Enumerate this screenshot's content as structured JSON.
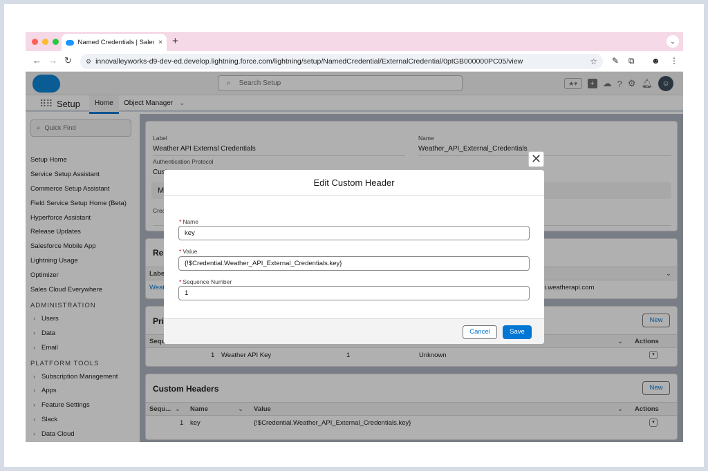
{
  "browser": {
    "tab_title": "Named Credentials | Salesforce",
    "tab_close": "×",
    "new_tab": "+",
    "url": "innovalleyworks-d9-dev-ed.develop.lightning.force.com/lightning/setup/NamedCredential/ExternalCredential/0ptGB000000PC05/view"
  },
  "header": {
    "search_placeholder": "Search Setup"
  },
  "nav": {
    "app_name": "Setup",
    "tabs": [
      {
        "label": "Home"
      },
      {
        "label": "Object Manager"
      }
    ]
  },
  "sidebar": {
    "quick_find_placeholder": "Quick Find",
    "items": [
      "Setup Home",
      "Service Setup Assistant",
      "Commerce Setup Assistant",
      "Field Service Setup Home (Beta)",
      "Hyperforce Assistant",
      "Release Updates",
      "Salesforce Mobile App",
      "Lightning Usage",
      "Optimizer",
      "Sales Cloud Everywhere"
    ],
    "administration_heading": "ADMINISTRATION",
    "administration_items": [
      "Users",
      "Data",
      "Email"
    ],
    "platform_heading": "PLATFORM TOOLS",
    "platform_items": [
      "Subscription Management",
      "Apps",
      "Feature Settings",
      "Slack",
      "Data Cloud"
    ]
  },
  "details": {
    "label_label": "Label",
    "label_value": "Weather API External Credentials",
    "name_label": "Name",
    "name_value": "Weather_API_External_Credentials",
    "auth_label": "Authentication Protocol",
    "auth_value": "Custom",
    "section_partial": "Ma",
    "created_partial": "Crea"
  },
  "related": {
    "title_partial": "Rel",
    "label_partial": "Labe",
    "link_partial": "Weat",
    "url_partial": "api.weatherapi.com"
  },
  "principals": {
    "title_partial": "Prin",
    "new_label": "New",
    "col_seq": "Sequ",
    "col_actions": "Actions",
    "row": {
      "seq": "1",
      "name": "Weather API Key",
      "num": "1",
      "status": "Unknown"
    }
  },
  "custom_headers": {
    "title": "Custom Headers",
    "new_label": "New",
    "columns": {
      "seq": "Sequ...",
      "name": "Name",
      "value": "Value",
      "actions": "Actions"
    },
    "row": {
      "seq": "1",
      "name": "key",
      "value": "{!$Credential.Weather_API_External_Credentials.key}"
    }
  },
  "modal": {
    "title": "Edit Custom Header",
    "close": "✕",
    "name_label": "Name",
    "name_value": "key",
    "value_label": "Value",
    "value_value": "{!$Credential.Weather_API_External_Credentials.key}",
    "seq_label": "Sequence Number",
    "seq_value": "1",
    "required_mark": "*",
    "cancel_label": "Cancel",
    "save_label": "Save"
  },
  "colors": {
    "brand_blue": "#0176d3",
    "tab_bar": "#f6d9e6",
    "required": "#ba0517"
  }
}
